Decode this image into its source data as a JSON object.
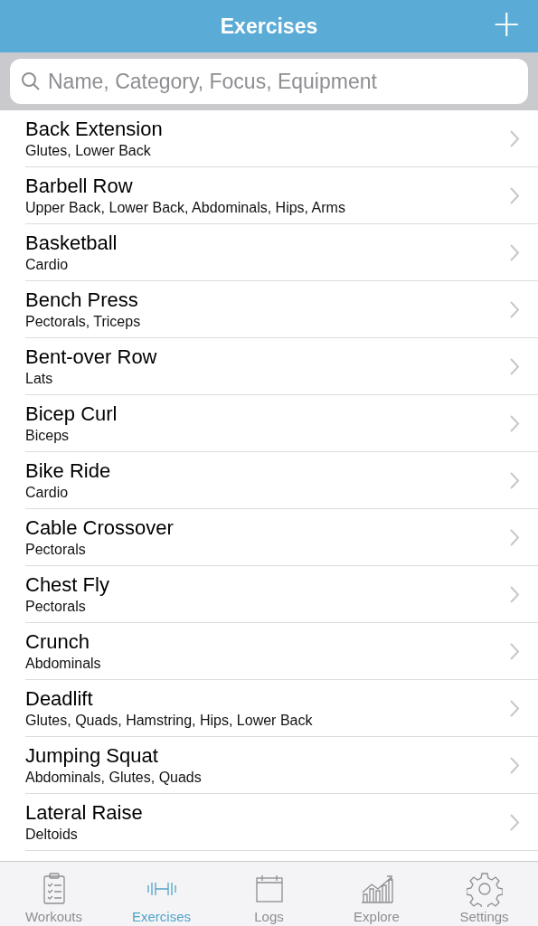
{
  "nav_bar": {
    "title": "Exercises",
    "add_button": "+"
  },
  "search": {
    "placeholder": "Name, Category, Focus, Equipment"
  },
  "exercises": [
    {
      "name": "Back Extension",
      "focus": "Glutes, Lower Back"
    },
    {
      "name": "Barbell Row",
      "focus": "Upper Back, Lower Back, Abdominals, Hips, Arms"
    },
    {
      "name": "Basketball",
      "focus": "Cardio"
    },
    {
      "name": "Bench Press",
      "focus": "Pectorals, Triceps"
    },
    {
      "name": "Bent-over Row",
      "focus": "Lats"
    },
    {
      "name": "Bicep Curl",
      "focus": "Biceps"
    },
    {
      "name": "Bike Ride",
      "focus": "Cardio"
    },
    {
      "name": "Cable Crossover",
      "focus": "Pectorals"
    },
    {
      "name": "Chest Fly",
      "focus": "Pectorals"
    },
    {
      "name": "Crunch",
      "focus": "Abdominals"
    },
    {
      "name": "Deadlift",
      "focus": "Glutes, Quads, Hamstring, Hips, Lower Back"
    },
    {
      "name": "Jumping Squat",
      "focus": "Abdominals, Glutes, Quads"
    },
    {
      "name": "Lateral Raise",
      "focus": "Deltoids"
    }
  ],
  "tab_bar": [
    {
      "label": "Workouts",
      "kind": "clipboard",
      "selected": false
    },
    {
      "label": "Exercises",
      "kind": "dumbbell",
      "selected": true
    },
    {
      "label": "Logs",
      "kind": "calendar",
      "selected": false
    },
    {
      "label": "Explore",
      "kind": "chart",
      "selected": false
    },
    {
      "label": "Settings",
      "kind": "gear",
      "selected": false
    }
  ]
}
